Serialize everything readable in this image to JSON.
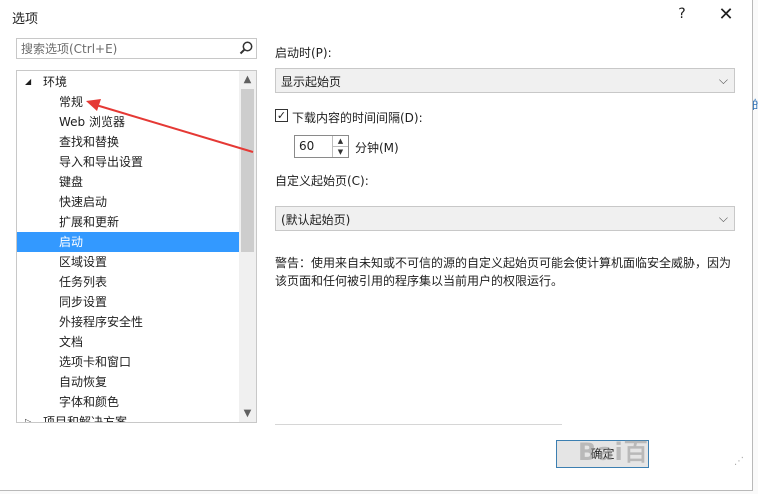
{
  "window": {
    "title": "选项",
    "help_label": "?",
    "close_label": "✕"
  },
  "search": {
    "placeholder": "搜索选项(Ctrl+E)",
    "icon": "search-icon"
  },
  "tree": {
    "items": [
      {
        "label": "环境",
        "level": "parent",
        "expanded": true
      },
      {
        "label": "常规",
        "level": "child"
      },
      {
        "label": "Web 浏览器",
        "level": "child"
      },
      {
        "label": "查找和替换",
        "level": "child"
      },
      {
        "label": "导入和导出设置",
        "level": "child"
      },
      {
        "label": "键盘",
        "level": "child"
      },
      {
        "label": "快速启动",
        "level": "child"
      },
      {
        "label": "扩展和更新",
        "level": "child"
      },
      {
        "label": "启动",
        "level": "child",
        "selected": true
      },
      {
        "label": "区域设置",
        "level": "child"
      },
      {
        "label": "任务列表",
        "level": "child"
      },
      {
        "label": "同步设置",
        "level": "child"
      },
      {
        "label": "外接程序安全性",
        "level": "child"
      },
      {
        "label": "文档",
        "level": "child"
      },
      {
        "label": "选项卡和窗口",
        "level": "child"
      },
      {
        "label": "自动恢复",
        "level": "child"
      },
      {
        "label": "字体和颜色",
        "level": "child"
      },
      {
        "label": "项目和解决方案",
        "level": "parent",
        "expanded": false
      }
    ]
  },
  "startup": {
    "on_startup_label": "启动时(P):",
    "on_startup_value": "显示起始页",
    "download_checkbox_label": "下载内容的时间间隔(D):",
    "download_checked": true,
    "interval_value": "60",
    "minutes_label": "分钟(M)",
    "custom_start_label": "自定义起始页(C):",
    "custom_start_value": "(默认起始页)",
    "warning_text": "警告：使用来自未知或不可信的源的自定义起始页可能会使计算机面临安全威胁，因为该页面和任何被引用的程序集以当前用户的权限运行。"
  },
  "footer": {
    "ok_label": "确定",
    "watermark": "Bai百"
  },
  "colors": {
    "selection": "#3399ff",
    "arrow": "#e53935"
  }
}
